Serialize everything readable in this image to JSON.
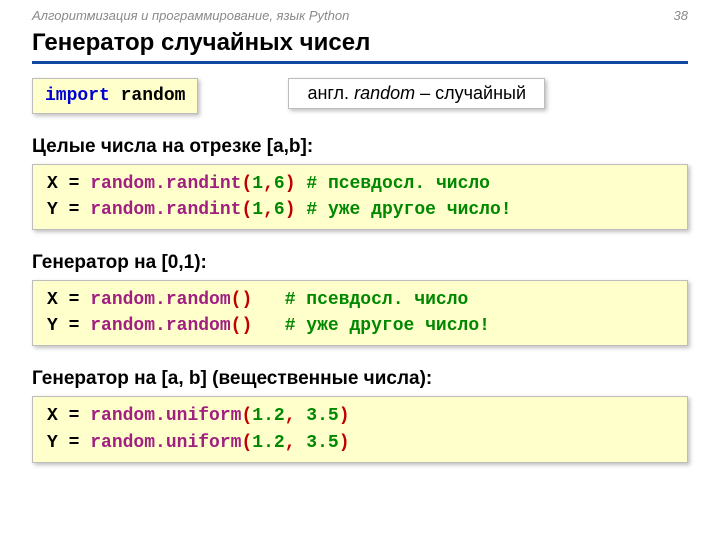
{
  "header": {
    "course": "Алгоритмизация и программирование, язык Python",
    "page": "38"
  },
  "title": "Генератор случайных чисел",
  "import_box": {
    "kw": "import",
    "sp": " ",
    "mod": "random"
  },
  "note": {
    "pre": "англ. ",
    "word": "random",
    "post": " – случайный"
  },
  "sec1": {
    "heading": "Целые числа на отрезке [a,b]:",
    "l1": {
      "lhs": "X",
      "eq": " = ",
      "obj": "random.",
      "fn": "randint",
      "open": "(",
      "a1": "1",
      "comma": ",",
      "a2": "6",
      "close": ")",
      "sp": " ",
      "cmt": "# псевдосл. число"
    },
    "l2": {
      "lhs": "Y",
      "eq": " = ",
      "obj": "random.",
      "fn": "randint",
      "open": "(",
      "a1": "1",
      "comma": ",",
      "a2": "6",
      "close": ")",
      "sp": " ",
      "cmt": "# уже другое число!"
    }
  },
  "sec2": {
    "heading": "Генератор на [0,1):",
    "l1": {
      "lhs": "X",
      "eq": " = ",
      "obj": "random.",
      "fn": "random",
      "open": "(",
      "close": ")",
      "sp": "   ",
      "cmt": "# псевдосл. число"
    },
    "l2": {
      "lhs": "Y",
      "eq": " = ",
      "obj": "random.",
      "fn": "random",
      "open": "(",
      "close": ")",
      "sp": "   ",
      "cmt": "# уже другое число!"
    }
  },
  "sec3": {
    "heading": "Генератор на [a, b] (вещественные числа):",
    "l1": {
      "lhs": "X",
      "eq": " = ",
      "obj": "random.",
      "fn": "uniform",
      "open": "(",
      "a1": "1.2",
      "comma": ", ",
      "a2": "3.5",
      "close": ")"
    },
    "l2": {
      "lhs": "Y",
      "eq": " = ",
      "obj": "random.",
      "fn": "uniform",
      "open": "(",
      "a1": "1.2",
      "comma": ", ",
      "a2": "3.5",
      "close": ")"
    }
  }
}
